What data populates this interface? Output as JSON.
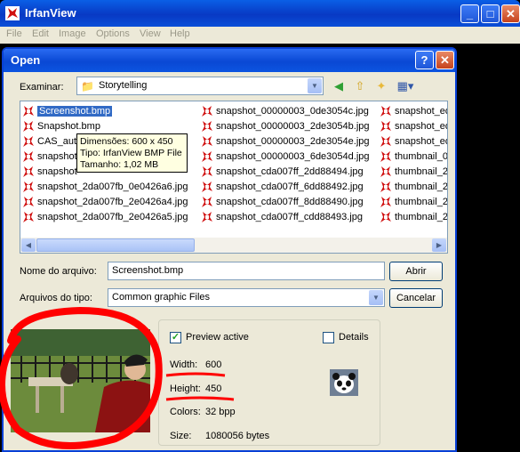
{
  "app": {
    "title": "IrfanView",
    "menu": [
      "File",
      "Edit",
      "Image",
      "Options",
      "View",
      "Help"
    ]
  },
  "dialog": {
    "title": "Open",
    "look_in_label": "Examinar:",
    "look_in_value": "Storytelling",
    "filename_label": "Nome do arquivo:",
    "filename_value": "Screenshot.bmp",
    "filetype_label": "Arquivos do tipo:",
    "filetype_value": "Common graphic Files",
    "open_label": "Abrir",
    "cancel_label": "Cancelar"
  },
  "files": {
    "col1": [
      "Screenshot.bmp",
      "Snapshot.bmp",
      "CAS_auto",
      "snapshot",
      "snapshot",
      "snapshot_2da007fb_0e0426a6.jpg",
      "snapshot_2da007fb_2e0426a4.jpg",
      "snapshot_2da007fb_2e0426a5.jpg"
    ],
    "col2": [
      "snapshot_00000003_0de3054c.jpg",
      "snapshot_00000003_2de3054b.jpg",
      "snapshot_00000003_2de3054e.jpg",
      "snapshot_00000003_6de3054d.jpg",
      "snapshot_cda007ff_2dd88494.jpg",
      "snapshot_cda007ff_6dd88492.jpg",
      "snapshot_cda007ff_8dd88490.jpg",
      "snapshot_cda007ff_cdd88493.jpg"
    ],
    "col3": [
      "snapshot_ed",
      "snapshot_ed",
      "snapshot_ed",
      "thumbnail_00",
      "thumbnail_2d",
      "thumbnail_2d",
      "thumbnail_2d",
      "thumbnail_2d"
    ],
    "selected": "Screenshot.bmp"
  },
  "tooltip": {
    "line1": "Dimensões: 600 x 450",
    "line2": "Tipo: IrfanView BMP File",
    "line3": "Tamanho: 1,02 MB"
  },
  "preview": {
    "preview_active_label": "Preview active",
    "preview_active_checked": true,
    "details_label": "Details",
    "details_checked": false,
    "width_label": "Width:",
    "width_value": "600",
    "height_label": "Height:",
    "height_value": "450",
    "colors_label": "Colors:",
    "colors_value": "32 bpp",
    "size_label": "Size:",
    "size_value": "1080056 bytes"
  },
  "colors": {
    "xp_blue": "#0a48d4",
    "dialog_bg": "#ece9d8",
    "selection": "#316ac5",
    "annotation_red": "#ff0000",
    "tooltip_bg": "#ffffe1"
  }
}
